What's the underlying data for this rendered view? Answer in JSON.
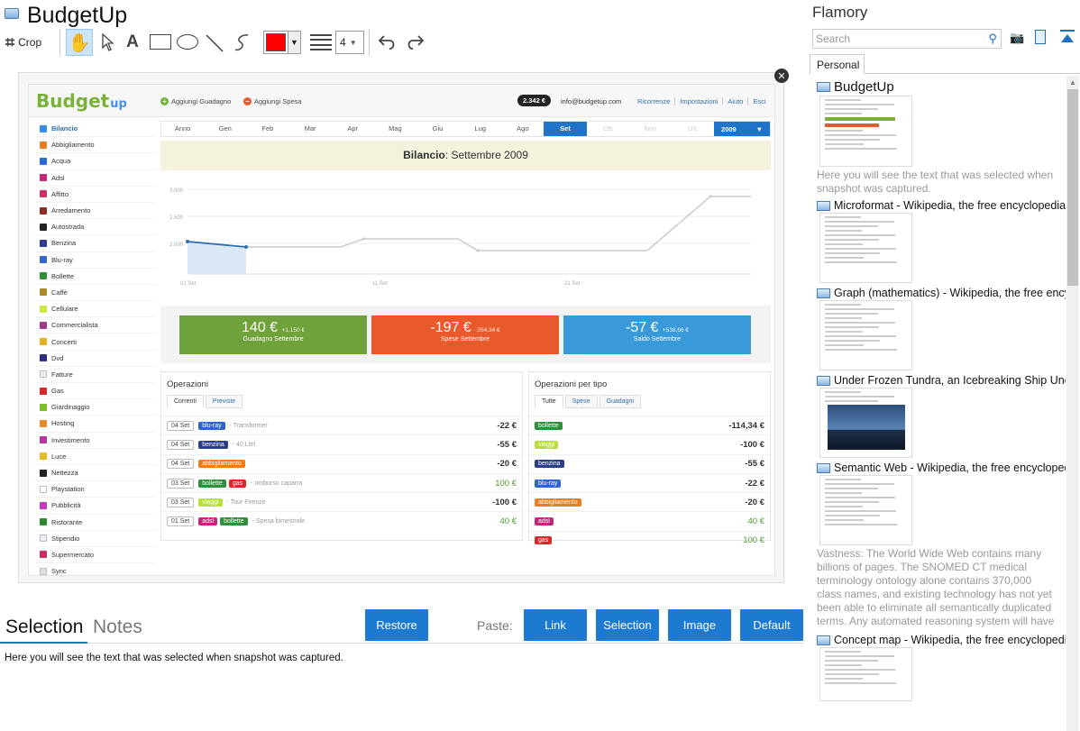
{
  "app": {
    "title": "BudgetUp"
  },
  "toolbar": {
    "crop_label": "Crop",
    "line_width": "4",
    "color": "#ff0000",
    "icons": [
      "crop-icon",
      "hand-icon",
      "pointer-icon",
      "text-icon",
      "rectangle-icon",
      "ellipse-icon",
      "line-icon",
      "pen-icon",
      "line-width-icon",
      "undo-icon",
      "redo-icon"
    ]
  },
  "snapshot": {
    "header": {
      "logo": "Budget",
      "logo_up": "up",
      "add_income": "Aggiungi Guadagno",
      "add_expense": "Aggiungi Spesa",
      "balance_badge": "2.342 €",
      "email": "info@budgetup.com",
      "menu": [
        "Ricorrenze",
        "Impostazioni",
        "Aiuto",
        "Esci"
      ]
    },
    "categories": [
      {
        "name": "Bilancio",
        "color": "#3a8dde"
      },
      {
        "name": "Abbigliamento",
        "color": "#e67e22"
      },
      {
        "name": "Acqua",
        "color": "#2c6bd6"
      },
      {
        "name": "Adsl",
        "color": "#c0287a"
      },
      {
        "name": "Affitto",
        "color": "#c82f6d"
      },
      {
        "name": "Arredamento",
        "color": "#8e2b2b"
      },
      {
        "name": "Autostrada",
        "color": "#222222"
      },
      {
        "name": "Benzina",
        "color": "#2c3e8a"
      },
      {
        "name": "Blu-ray",
        "color": "#2f64c8"
      },
      {
        "name": "Bollette",
        "color": "#2f8f3a"
      },
      {
        "name": "Caffè",
        "color": "#a8892a"
      },
      {
        "name": "Cellulare",
        "color": "#c8e84a"
      },
      {
        "name": "Commercialista",
        "color": "#a03c8c"
      },
      {
        "name": "Concerti",
        "color": "#e1b12c"
      },
      {
        "name": "Dvd",
        "color": "#2d2d8a"
      },
      {
        "name": "Fatture",
        "color": "#e6edf5"
      },
      {
        "name": "Gas",
        "color": "#d62a2a"
      },
      {
        "name": "Giardinaggio",
        "color": "#7bbf2a"
      },
      {
        "name": "Hosting",
        "color": "#e48a2c"
      },
      {
        "name": "Investimento",
        "color": "#b2359c"
      },
      {
        "name": "Luce",
        "color": "#e8b92a"
      },
      {
        "name": "Nettezza",
        "color": "#222222"
      },
      {
        "name": "Playstation",
        "color": "#ffffff"
      },
      {
        "name": "Pubblicità",
        "color": "#c33cc0"
      },
      {
        "name": "Ristorante",
        "color": "#2f8a2f"
      },
      {
        "name": "Stipendio",
        "color": "#e7eef6"
      },
      {
        "name": "Supermercato",
        "color": "#c52f6a"
      },
      {
        "name": "Sync",
        "color": "#e0e0e0"
      }
    ],
    "months": [
      "Anno",
      "Gen",
      "Feb",
      "Mar",
      "Apr",
      "Mag",
      "Giu",
      "Lug",
      "Ago",
      "Set",
      "Ott",
      "Nov",
      "Dic"
    ],
    "selected_month": "Set",
    "year": "2009",
    "title_prefix": "Bilancio",
    "title_suffix": ": Settembre 2009",
    "tiles": [
      {
        "big": "140 €",
        "small": "+1.150 €",
        "label": "Guadagno Settembre",
        "color": "#6fa23a"
      },
      {
        "big": "-197 €",
        "small": "-254,34 €",
        "label": "Spese Settembre",
        "color": "#e8592b"
      },
      {
        "big": "-57 €",
        "small": "+538,66 €",
        "label": "Saldo Settembre",
        "color": "#3a9ad9"
      }
    ],
    "operations": {
      "title": "Operazioni",
      "tabs": [
        "Correnti",
        "Previste"
      ],
      "rows": [
        {
          "date": "04 Set",
          "tags": [
            {
              "t": "blu-ray",
              "c": "#2f64c8"
            }
          ],
          "note": "- Transformer",
          "amount": "-22 €",
          "pos": false
        },
        {
          "date": "04 Set",
          "tags": [
            {
              "t": "benzina",
              "c": "#2c3e8a"
            }
          ],
          "note": "- 40 Litri",
          "amount": "-55 €",
          "pos": false
        },
        {
          "date": "04 Set",
          "tags": [
            {
              "t": "abbigliamento",
              "c": "#e67e22"
            }
          ],
          "note": "",
          "amount": "-20 €",
          "pos": false
        },
        {
          "date": "03 Set",
          "tags": [
            {
              "t": "bollette",
              "c": "#2f8f3a"
            },
            {
              "t": "gas",
              "c": "#d62a2a"
            }
          ],
          "note": "- rimborso caparra",
          "amount": "100 €",
          "pos": true
        },
        {
          "date": "03 Set",
          "tags": [
            {
              "t": "viaggi",
              "c": "#b9e03a"
            }
          ],
          "note": "- Tour Firenze",
          "amount": "-100 €",
          "pos": false
        },
        {
          "date": "01 Set",
          "tags": [
            {
              "t": "adsl",
              "c": "#c0287a"
            },
            {
              "t": "bollette",
              "c": "#2f8f3a"
            }
          ],
          "note": "- Spesa bimestrale",
          "amount": "40 €",
          "pos": true
        }
      ]
    },
    "operations_by_type": {
      "title": "Operazioni per tipo",
      "tabs": [
        "Tutte",
        "Spese",
        "Guadagni"
      ],
      "rows": [
        {
          "tag": "bollette",
          "c": "#2f8f3a",
          "amount": "-114,34 €",
          "pos": false
        },
        {
          "tag": "viaggi",
          "c": "#b9e03a",
          "amount": "-100 €",
          "pos": false
        },
        {
          "tag": "benzina",
          "c": "#2c3e8a",
          "amount": "-55 €",
          "pos": false
        },
        {
          "tag": "blu-ray",
          "c": "#2f64c8",
          "amount": "-22 €",
          "pos": false
        },
        {
          "tag": "abbigliamento",
          "c": "#e67e22",
          "amount": "-20 €",
          "pos": false
        },
        {
          "tag": "adsl",
          "c": "#c0287a",
          "amount": "40 €",
          "pos": true
        },
        {
          "tag": "gas",
          "c": "#d62a2a",
          "amount": "100 €",
          "pos": true
        }
      ]
    },
    "chart": {
      "y_ticks": [
        "3.000",
        "2.500",
        "2.000"
      ],
      "x_ticks": [
        "01 Set",
        "11 Set",
        "21 Set"
      ]
    }
  },
  "bottom": {
    "tab_selection": "Selection",
    "tab_notes": "Notes",
    "restore": "Restore",
    "paste_label": "Paste:",
    "link": "Link",
    "selection": "Selection",
    "image": "Image",
    "default": "Default",
    "selection_text": "Here you will see the text that was selected when snapshot was captured."
  },
  "sidebar": {
    "title": "Flamory",
    "search_placeholder": "Search",
    "tab_personal": "Personal",
    "items": [
      {
        "title": "BudgetUp",
        "desc": "Here you will see the text that was selected when snapshot was captured."
      },
      {
        "title": "Microformat - Wikipedia, the free encyclopedia",
        "desc": ""
      },
      {
        "title": "Graph (mathematics) - Wikipedia, the free ency",
        "desc": ""
      },
      {
        "title": "Under Frozen Tundra, an Icebreaking Ship Unco",
        "desc": ""
      },
      {
        "title": "Semantic Web - Wikipedia, the free encycloped",
        "desc": "Vastness: The World Wide Web contains many billions of pages. The SNOMED CT medical terminology ontology alone contains 370,000 class names, and existing technology has not yet been able to eliminate all semantically duplicated terms. Any automated reasoning system will have to deal with truly huge inputs."
      },
      {
        "title": "Concept map - Wikipedia, the free encyclopedia",
        "desc": ""
      }
    ]
  }
}
